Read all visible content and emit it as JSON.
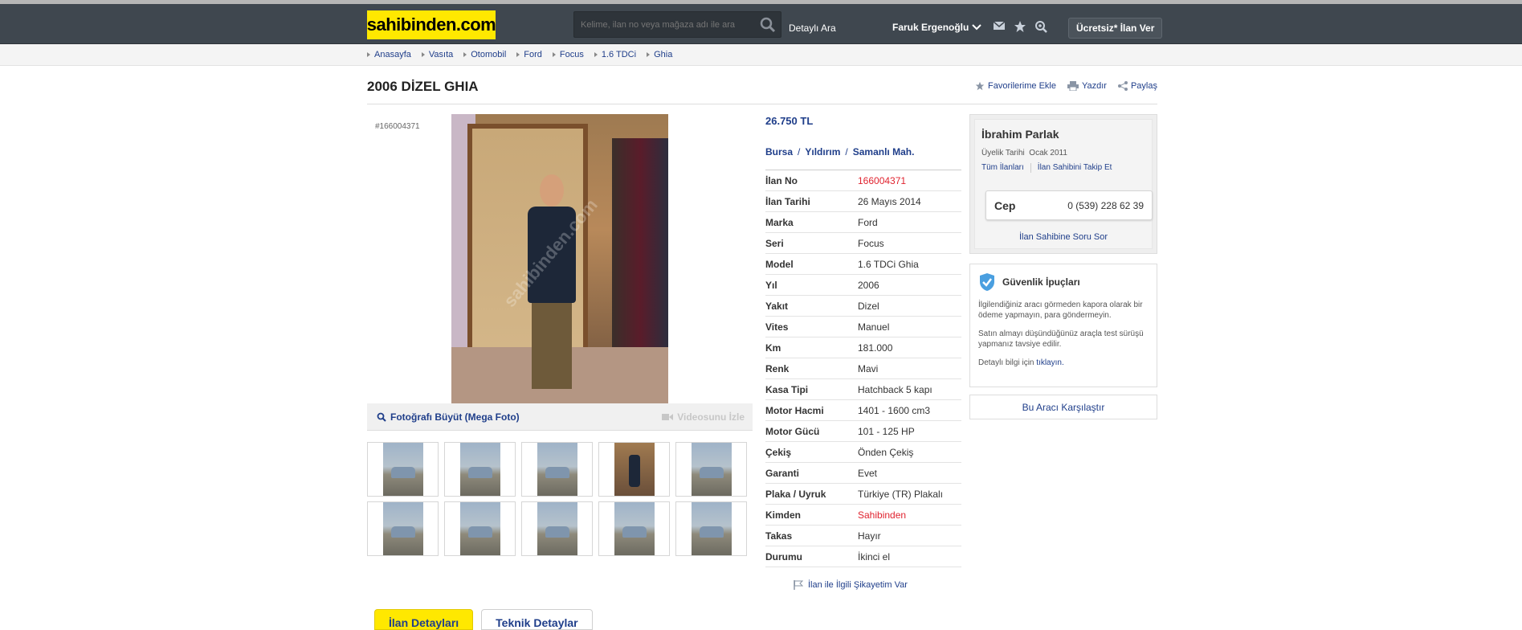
{
  "header": {
    "logo": "sahibinden.com",
    "search_placeholder": "Kelime, ilan no veya mağaza adı ile ara",
    "detailed_search": "Detaylı Ara",
    "user_name": "Faruk Ergenoğlu",
    "post_ad": "Ücretsiz* İlan Ver"
  },
  "breadcrumb": [
    "Anasayfa",
    "Vasıta",
    "Otomobil",
    "Ford",
    "Focus",
    "1.6 TDCi",
    "Ghia"
  ],
  "listing": {
    "title": "2006 DİZEL GHIA",
    "actions": {
      "favorite": "Favorilerime Ekle",
      "print": "Yazdır",
      "share": "Paylaş"
    },
    "id_label": "#166004371",
    "photo_watermark": "sahibinden.com",
    "zoom_label": "Fotoğrafı Büyüt (Mega Foto)",
    "video_label": "Videosunu İzle",
    "price": "26.750 TL",
    "location": {
      "city": "Bursa",
      "district": "Yıldırım",
      "neighborhood": "Samanlı Mah."
    },
    "details": [
      {
        "k": "İlan No",
        "v": "166004371",
        "red": true
      },
      {
        "k": "İlan Tarihi",
        "v": "26 Mayıs 2014"
      },
      {
        "k": "Marka",
        "v": "Ford"
      },
      {
        "k": "Seri",
        "v": "Focus"
      },
      {
        "k": "Model",
        "v": "1.6 TDCi Ghia"
      },
      {
        "k": "Yıl",
        "v": "2006"
      },
      {
        "k": "Yakıt",
        "v": "Dizel"
      },
      {
        "k": "Vites",
        "v": "Manuel"
      },
      {
        "k": "Km",
        "v": "181.000"
      },
      {
        "k": "Renk",
        "v": "Mavi"
      },
      {
        "k": "Kasa Tipi",
        "v": "Hatchback 5 kapı"
      },
      {
        "k": "Motor Hacmi",
        "v": "1401 - 1600 cm3"
      },
      {
        "k": "Motor Gücü",
        "v": "101 - 125 HP"
      },
      {
        "k": "Çekiş",
        "v": "Önden Çekiş"
      },
      {
        "k": "Garanti",
        "v": "Evet"
      },
      {
        "k": "Plaka / Uyruk",
        "v": "Türkiye (TR) Plakalı"
      },
      {
        "k": "Kimden",
        "v": "Sahibinden",
        "red": true
      },
      {
        "k": "Takas",
        "v": "Hayır"
      },
      {
        "k": "Durumu",
        "v": "İkinci el"
      }
    ],
    "complain": "İlan ile İlgili Şikayetim Var"
  },
  "seller": {
    "name": "İbrahim Parlak",
    "member_since_label": "Üyelik Tarihi",
    "member_since": "Ocak 2011",
    "all_ads": "Tüm İlanları",
    "follow": "İlan Sahibini Takip Et",
    "phone_label": "Cep",
    "phone": "0 (539) 228 62 39",
    "ask": "İlan Sahibine Soru Sor"
  },
  "safety": {
    "title": "Güvenlik İpuçları",
    "p1": "İlgilendiğiniz aracı görmeden kapora olarak bir ödeme yapmayın, para göndermeyin.",
    "p2": "Satın almayı düşündüğünüz araçla test sürüşü yapmanız tavsiye edilir.",
    "p3_prefix": "Detaylı bilgi için",
    "p3_link": "tıklayın."
  },
  "compare": "Bu Aracı Karşılaştır",
  "tabs": [
    "İlan Detayları",
    "Teknik Detaylar"
  ],
  "colors": {
    "brand_yellow": "#ffe800",
    "header_bg": "#3f474f",
    "link_blue": "#1f3e8a",
    "red": "#e0232f"
  }
}
